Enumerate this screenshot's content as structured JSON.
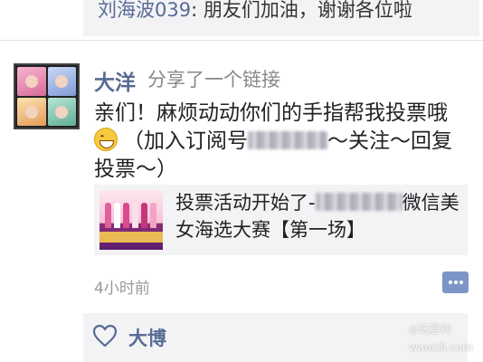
{
  "previous_comment": {
    "author": "刘海波039",
    "separator": ": ",
    "text": "朋友们加油，谢谢各位啦"
  },
  "post": {
    "author": "大洋",
    "action": "分享了一个链接",
    "text_part1": "亲们！麻烦动动你们的手指帮我投票哦",
    "emoji_icon": "grin-emoji-icon",
    "text_part2": "（加入订阅号",
    "text_part3": "～关注～回复投票～）",
    "link": {
      "title_part1": "投票活动开始了-",
      "title_part2": "微信美女海选大赛【第一场】"
    },
    "timestamp": "4小时前"
  },
  "likes": {
    "icon": "heart-icon",
    "names": "大博"
  },
  "watermark": {
    "line1": "◎玩意利",
    "line2": "wancili.com"
  },
  "colors": {
    "name_blue": "#576b95",
    "card_bg": "#f3f3f5",
    "comment_button": "#7d95c6"
  }
}
